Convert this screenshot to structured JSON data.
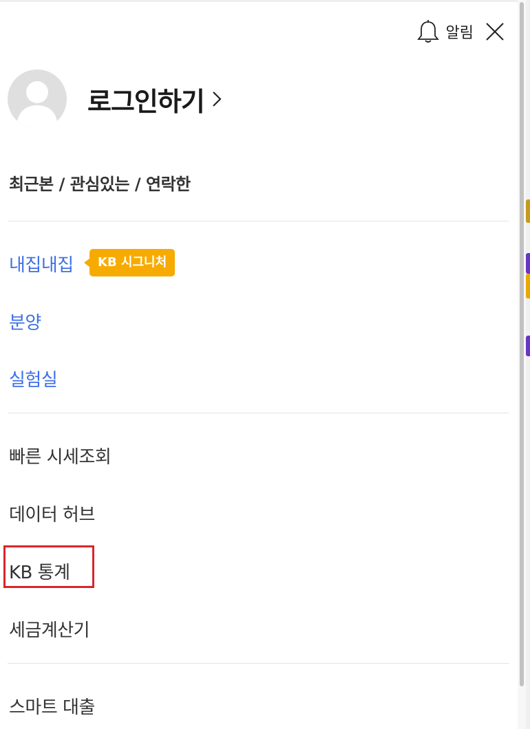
{
  "header": {
    "alarm_label": "알림",
    "bell_icon": "bell-icon",
    "close_icon": "close-icon"
  },
  "profile": {
    "login_label": "로그인하기",
    "chevron_icon": "chevron-right-icon",
    "avatar_icon": "user-avatar-icon"
  },
  "recent_links_label": "최근본 / 관심있는 / 연락한",
  "menu": {
    "group1": [
      {
        "label": "내집내집"
      },
      {
        "label": "분양"
      },
      {
        "label": "실험실"
      }
    ],
    "badge_label": "KB 시그니처",
    "group2": [
      {
        "label": "빠른 시세조회"
      },
      {
        "label": "데이터 허브"
      },
      {
        "label": "KB 통계"
      },
      {
        "label": "세금계산기"
      }
    ],
    "group3": [
      {
        "label": "스마트 대출"
      }
    ]
  },
  "colors": {
    "link_blue": "#3d6fe4",
    "badge_bg": "#f7ab00",
    "highlight_red": "#d9252b"
  }
}
